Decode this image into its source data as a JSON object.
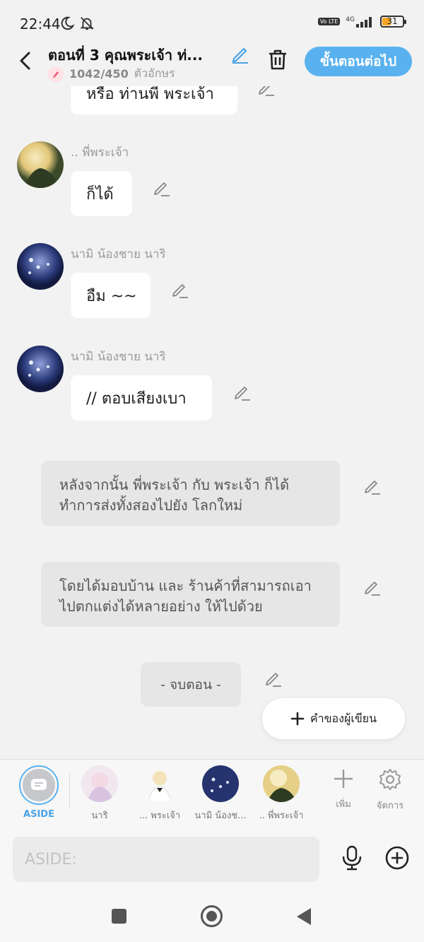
{
  "status_bar": {
    "time": "22:44",
    "network": "4G",
    "volte": "Vo LTE",
    "battery": "31"
  },
  "header": {
    "title": "ตอนที่ 3 คุณพระเจ้า ท่...",
    "char_count": "1042/450",
    "char_unit": "ตัวอักษร",
    "next_button": "ขั้นตอนต่อไป"
  },
  "messages": [
    {
      "speaker": "",
      "text": "หรือ ท่านพี พระเจ้า"
    },
    {
      "speaker": ".. พี่พระเจ้า",
      "text": "ก็ได้"
    },
    {
      "speaker": "นามิ น้องชาย นาริ",
      "text": "อืม ~~"
    },
    {
      "speaker": "นามิ น้องชาย นาริ",
      "text": "// ตอบเสียงเบา"
    }
  ],
  "narrations": [
    {
      "line1": "หลังจากนั้น พี่พระเจ้า กับ พระเจ้า ก็ได้",
      "line2": "ทำการส่งทั้งสองไปยัง โลกใหม่"
    },
    {
      "line1": "โดยได้มอบบ้าน และ ร้านค้าที่สามารถเอา",
      "line2": "ไปตกแต่งได้หลายอย่าง ให้ไปด้วย"
    }
  ],
  "end_label": "- จบตอน -",
  "author_button": "คำของผู้เขียน",
  "characters": {
    "aside": "ASIDE",
    "items": [
      {
        "label": "นาริ"
      },
      {
        "label": "... พระเจ้า"
      },
      {
        "label": "นามิ น้องช..."
      },
      {
        "label": ".. พี่พระเจ้า"
      }
    ],
    "add": "เพิ่ม",
    "manage": "จัดการ"
  },
  "input": {
    "placeholder": "ASIDE:"
  },
  "colors": {
    "accent": "#59b2ef",
    "background": "#f2f2f2",
    "bubble": "#ffffff",
    "narration": "#e6e6e6"
  }
}
